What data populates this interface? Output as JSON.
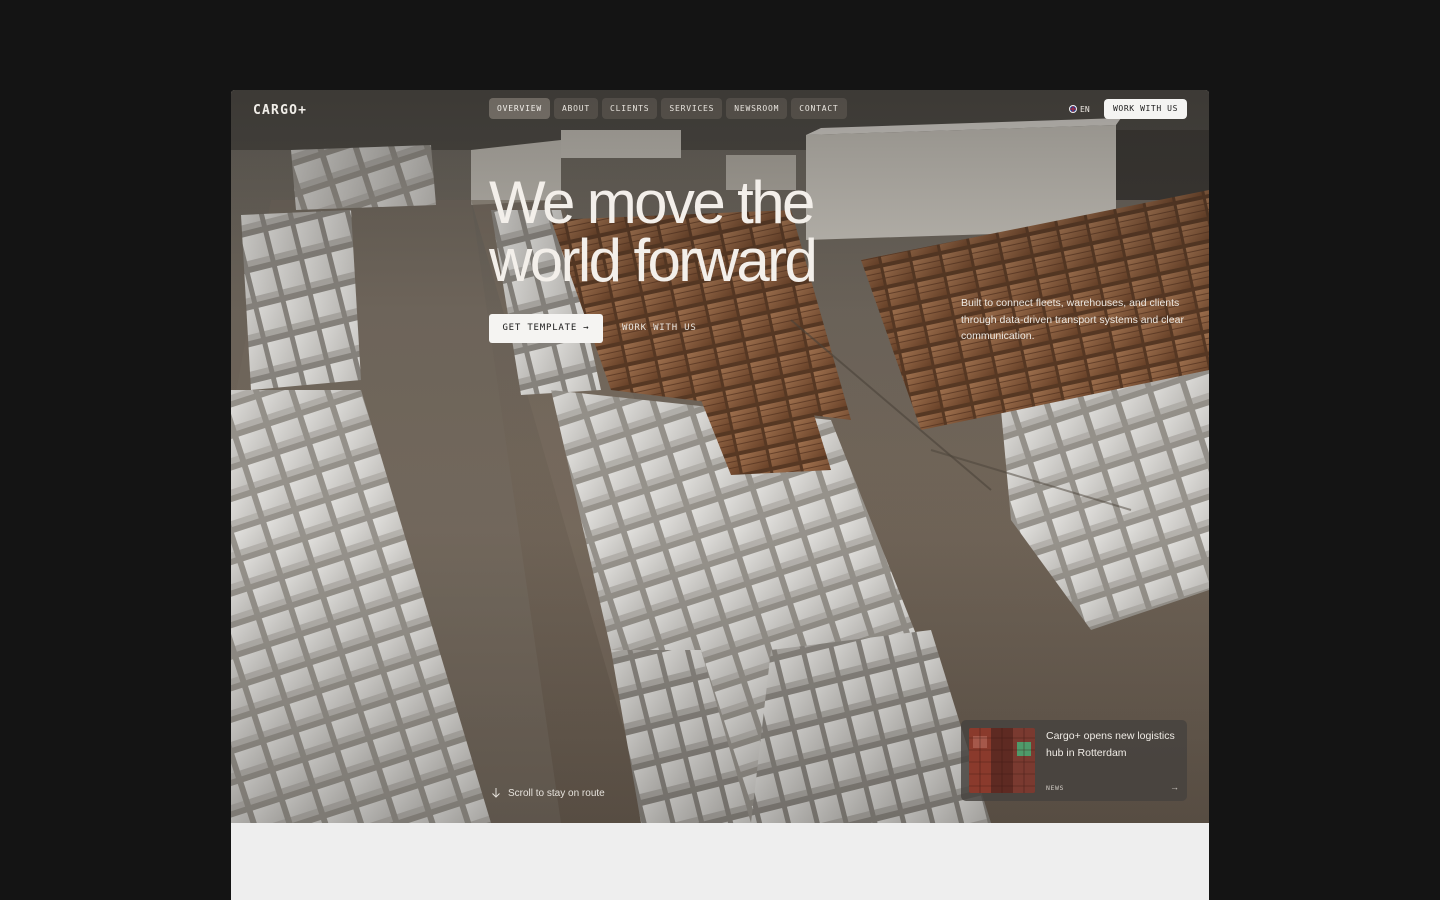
{
  "brand": {
    "logo_text": "CARGO+"
  },
  "nav": {
    "items": [
      {
        "label": "OVERVIEW",
        "active": true
      },
      {
        "label": "ABOUT",
        "active": false
      },
      {
        "label": "CLIENTS",
        "active": false
      },
      {
        "label": "SERVICES",
        "active": false
      },
      {
        "label": "NEWSROOM",
        "active": false
      },
      {
        "label": "CONTACT",
        "active": false
      }
    ],
    "language": "EN",
    "cta_label": "WORK WITH US"
  },
  "hero": {
    "headline_line1": "We move the",
    "headline_line2": "world forward",
    "primary_button": "GET TEMPLATE →",
    "secondary_button": "WORK WITH US",
    "tagline": "Built to connect fleets, warehouses, and clients through data-driven transport systems and clear communication.",
    "scroll_hint": "Scroll to stay on route"
  },
  "news_card": {
    "title": "Cargo+ opens new logistics hub in Rotterdam",
    "tag": "NEWS",
    "arrow": "→"
  },
  "colors": {
    "page_background": "#141414",
    "section_background": "#eeeeee",
    "primary_button_bg": "#f5f4f2",
    "text_light": "#f3efea"
  },
  "icons": {
    "logo": "cargo-plus-wordmark",
    "language": "uk-flag-icon",
    "scroll": "arrow-down-icon",
    "news_link": "arrow-right-icon"
  }
}
